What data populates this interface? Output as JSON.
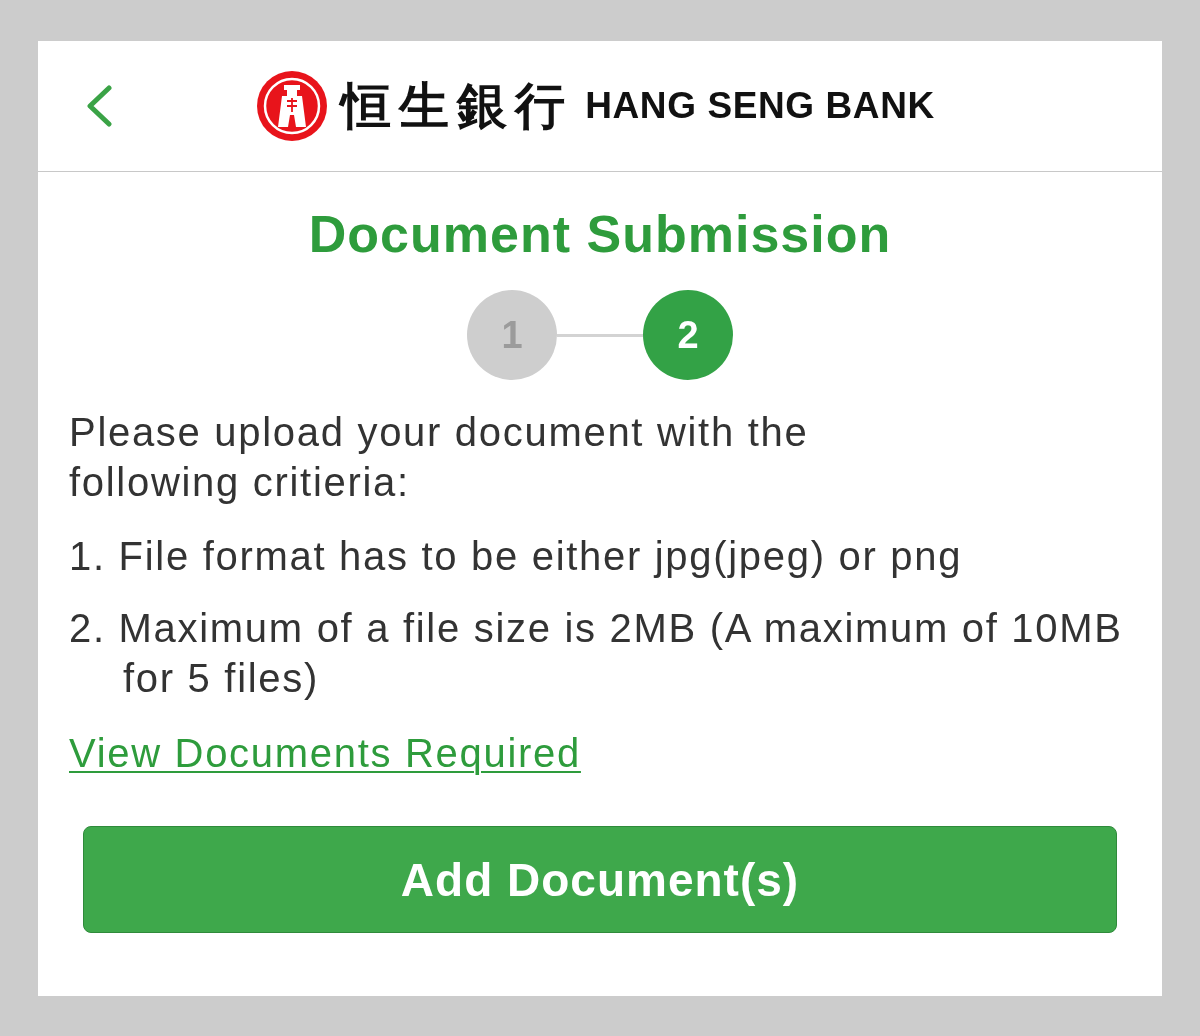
{
  "header": {
    "logo": {
      "chinese": "恒生銀行",
      "english": "HANG SENG BANK"
    }
  },
  "title": "Document Submission",
  "steps": [
    {
      "label": "1",
      "selected": false
    },
    {
      "label": "2",
      "selected": true
    }
  ],
  "intro": "Please upload your document with the following critieria:",
  "criteria": [
    "1. File format has to be either jpg(jpeg) or png",
    "2. Maximum of a file size is 2MB (A maximum of 10MB for 5 files)"
  ],
  "link": "View Documents Required",
  "button": "Add Document(s)"
}
